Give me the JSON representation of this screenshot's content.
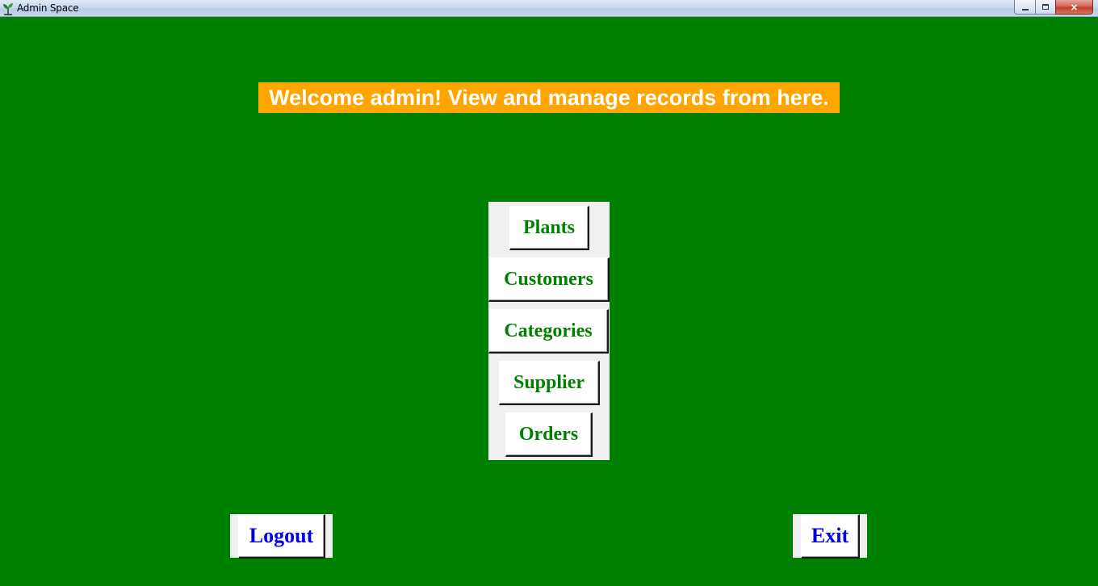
{
  "window": {
    "title": "Admin Space",
    "icon": "plant-app-icon",
    "controls": {
      "minimize": "minimize-icon",
      "maximize": "restore-icon",
      "close": "×"
    }
  },
  "banner": {
    "text": "Welcome admin! View and manage records from here."
  },
  "menu": {
    "plants": "Plants",
    "customers": "Customers",
    "categories": "Categories",
    "supplier": "Supplier",
    "orders": "Orders"
  },
  "footer": {
    "logout": "Logout",
    "exit": "Exit"
  },
  "colors": {
    "background": "#008000",
    "banner": "#ffa500",
    "menu_text": "#008000",
    "footer_text": "#0000e6",
    "frame": "#f0f0f0"
  }
}
